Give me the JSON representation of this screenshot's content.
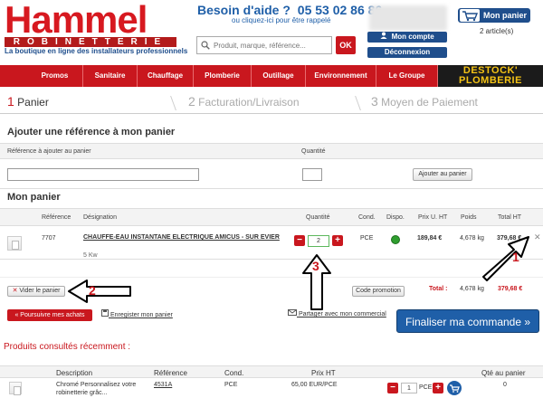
{
  "header": {
    "logo_word": "Hammel",
    "logo_sub": "ROBINETTERIE",
    "tagline": "La boutique en ligne des installateurs professionnels",
    "help_label": "Besoin d'aide ?",
    "help_phone": "05 53 02 86 86",
    "help_sub": "ou cliquez-ici pour être rappelé",
    "search_placeholder": "Produit, marque, référence...",
    "search_button": "OK",
    "account_button": "Mon compte",
    "logout_button": "Déconnexion",
    "cart_button": "Mon panier",
    "cart_count": "2 article(s)"
  },
  "nav": {
    "items": [
      "Promos",
      "Sanitaire",
      "Chauffage",
      "Plomberie",
      "Outillage",
      "Environnement",
      "Le Groupe"
    ],
    "destock_line1": "DESTOCK'",
    "destock_line2": "PLOMBERIE"
  },
  "steps": [
    {
      "num": "1",
      "label": "Panier"
    },
    {
      "num": "2",
      "label": "Facturation/Livraison"
    },
    {
      "num": "3",
      "label": "Moyen de Paiement"
    }
  ],
  "add_ref": {
    "title": "Ajouter une référence à mon panier",
    "col_ref": "Référence à ajouter au panier",
    "col_qty": "Quantité",
    "button": "Ajouter au panier"
  },
  "cart": {
    "title": "Mon panier",
    "columns": {
      "reference": "Référence",
      "designation": "Désignation",
      "quantite": "Quantité",
      "cond": "Cond.",
      "dispo": "Dispo.",
      "prix": "Prix U. HT",
      "poids": "Poids",
      "total": "Total HT"
    },
    "row": {
      "reference": "7707",
      "designation": "CHAUFFE-EAU INSTANTANE ELECTRIQUE AMICUS - SUR EVIER",
      "sub": "5 Kw",
      "quantity": "2",
      "cond": "PCE",
      "prix": "189,84 €",
      "poids": "4,678 kg",
      "total": "379,68 €"
    },
    "empty_button": "Vider le panier",
    "promo_button": "Code promotion",
    "total_label": "Total :",
    "total_weight": "4,678 kg",
    "total_ht": "379,68 €",
    "continue_button": "« Poursuivre mes achats",
    "save_link": "Enregister mon panier",
    "share_link": "Partager avec mon commercial",
    "finalize_button": "Finaliser ma commande »"
  },
  "viewed": {
    "title": "Produits consultés récemment :",
    "columns": {
      "description": "Description",
      "reference": "Référence",
      "cond": "Cond.",
      "prix": "Prix HT",
      "qty": "Qté au panier"
    },
    "row": {
      "description_line1": "Chromé Personnalisez votre",
      "description_line2": "robinetterie grâc...",
      "reference": "4531A",
      "cond": "PCE",
      "prix": "65,00 EUR/PCE",
      "qty": "1",
      "unit": "PCE",
      "stock": "0"
    }
  },
  "annotations": [
    "1",
    "2",
    "3"
  ],
  "colors": {
    "brand_red": "#c9171e",
    "brand_blue": "#1f4e8c",
    "cta_blue": "#1f5fa8",
    "available_green": "#2f9e2f"
  }
}
